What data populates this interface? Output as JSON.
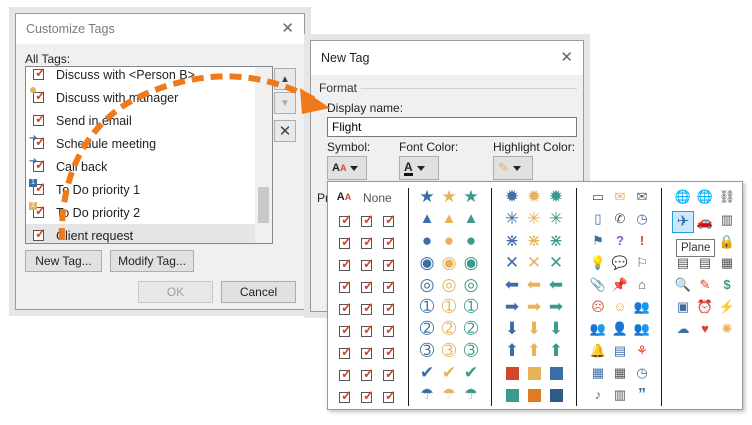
{
  "customize": {
    "title": "Customize Tags",
    "all_tags_label": "All Tags:",
    "tags": [
      {
        "label": "Discuss with <Person B>",
        "icon": "person-check-icon"
      },
      {
        "label": "Discuss with manager",
        "icon": "manager-check-icon"
      },
      {
        "label": "Send in email",
        "icon": "email-check-icon"
      },
      {
        "label": "Schedule meeting",
        "icon": "meeting-check-icon"
      },
      {
        "label": "Call back",
        "icon": "callback-check-icon"
      },
      {
        "label": "To Do priority 1",
        "icon": "priority1-check-icon"
      },
      {
        "label": "To Do priority 2",
        "icon": "priority2-check-icon"
      },
      {
        "label": "Client request",
        "icon": "client-check-icon"
      }
    ],
    "new_tag_button": "New Tag...",
    "modify_tag_button": "Modify Tag...",
    "ok_button": "OK",
    "cancel_button": "Cancel"
  },
  "newtag": {
    "title": "New Tag",
    "format_label": "Format",
    "display_name_label": "Display name:",
    "display_name_value": "Flight",
    "symbol_label": "Symbol:",
    "font_color_label": "Font Color:",
    "highlight_color_label": "Highlight Color:",
    "preview_label_fragment": "Pr"
  },
  "palette": {
    "none_label": "None",
    "tooltip": "Plane"
  },
  "colors": {
    "accent_blue": "#3b6ea5",
    "accent_gold": "#e6b35a",
    "accent_teal": "#3c9a8c",
    "accent_orange": "#e07b24",
    "accent_red": "#d2462b",
    "arrow_orange": "#f07a1a"
  }
}
